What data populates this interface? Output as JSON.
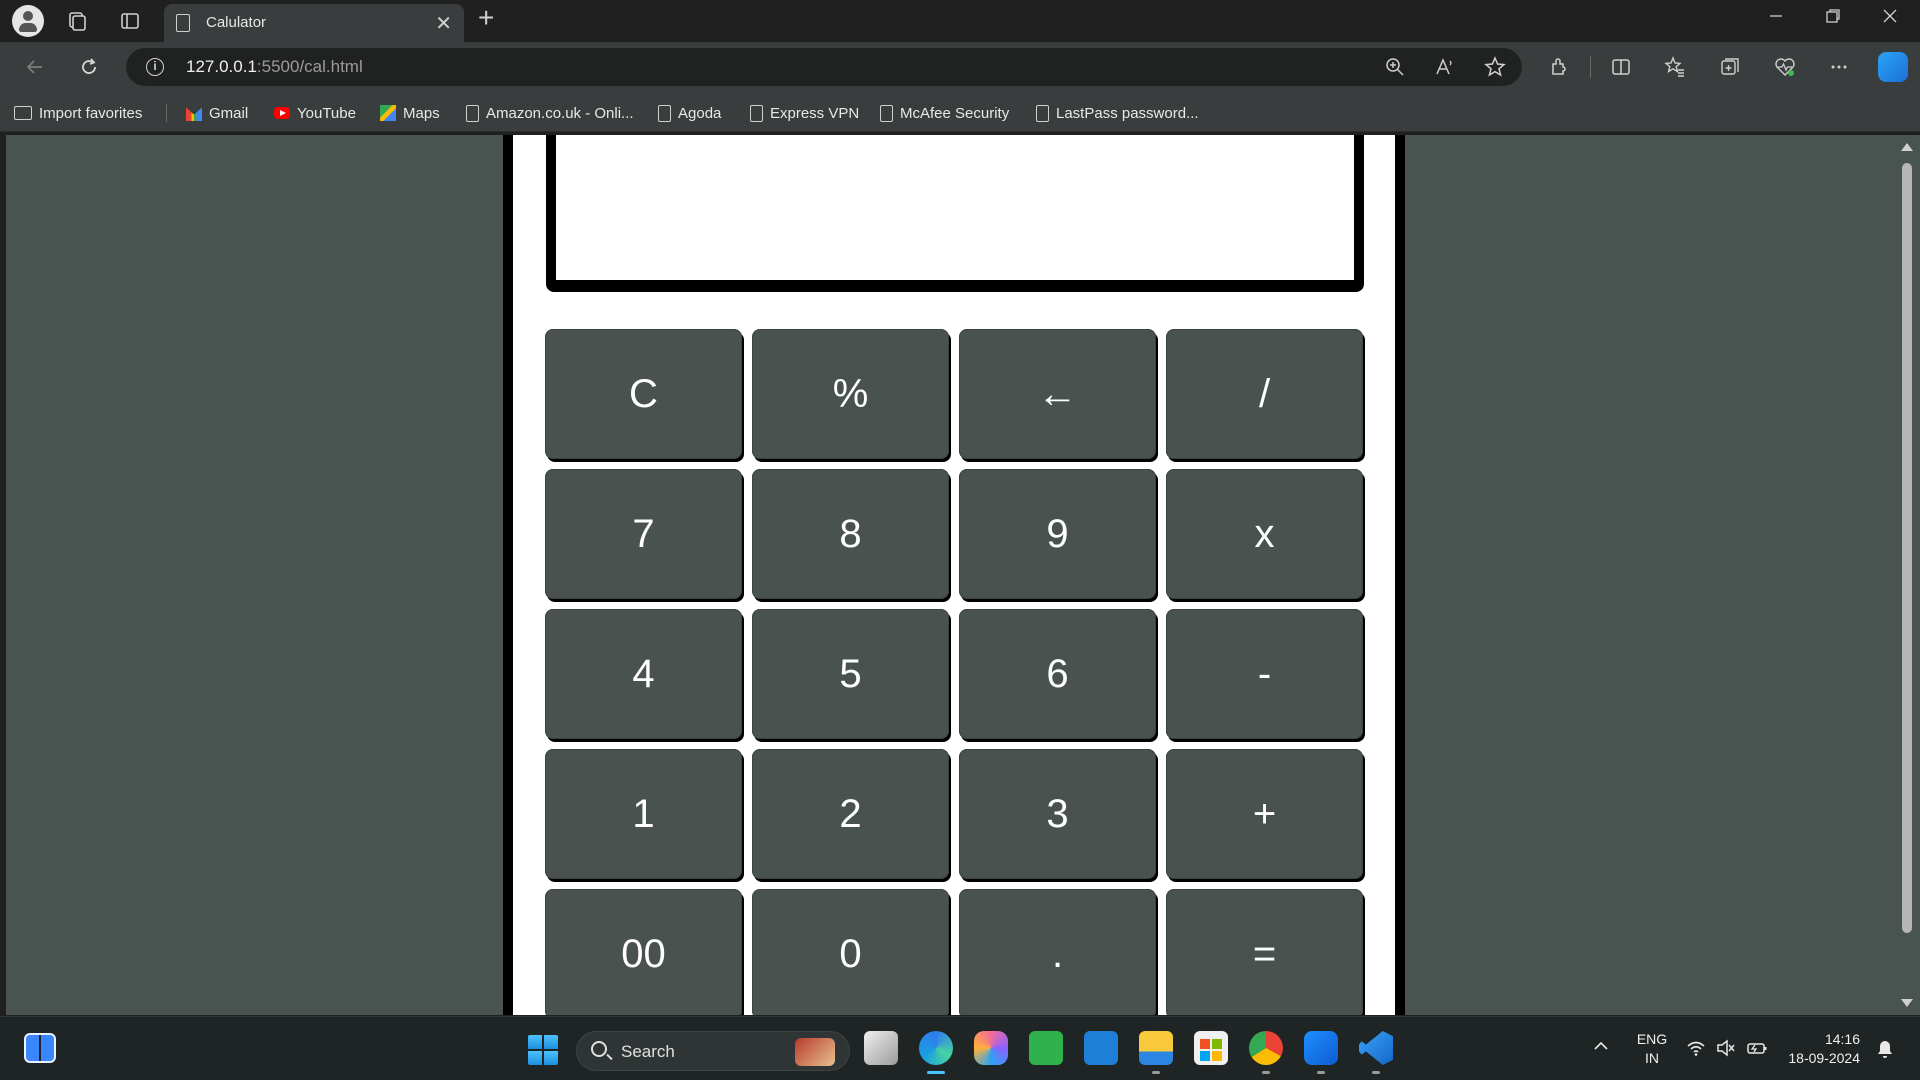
{
  "browser": {
    "tab_title": "Calulator",
    "url_host": "127.0.0.1",
    "url_rest": ":5500/cal.html",
    "new_tab_symbol": "+",
    "tab_close_symbol": "✕"
  },
  "favorites": [
    {
      "label": "Import favorites",
      "icon": "folder-import-icon"
    },
    {
      "label": "Gmail",
      "icon": "gmail-icon"
    },
    {
      "label": "YouTube",
      "icon": "youtube-icon"
    },
    {
      "label": "Maps",
      "icon": "maps-icon"
    },
    {
      "label": "Amazon.co.uk - Onli...",
      "icon": "page-icon"
    },
    {
      "label": "Agoda",
      "icon": "page-icon"
    },
    {
      "label": "Express VPN",
      "icon": "page-icon"
    },
    {
      "label": "McAfee Security",
      "icon": "page-icon"
    },
    {
      "label": "LastPass password...",
      "icon": "page-icon"
    }
  ],
  "calculator": {
    "display_value": "",
    "rows": [
      [
        "C",
        "%",
        "←",
        "/"
      ],
      [
        "7",
        "8",
        "9",
        "x"
      ],
      [
        "4",
        "5",
        "6",
        "-"
      ],
      [
        "1",
        "2",
        "3",
        "+"
      ],
      [
        "00",
        "0",
        ".",
        "="
      ]
    ]
  },
  "taskbar": {
    "search_label": "Search",
    "language_line1": "ENG",
    "language_line2": "IN",
    "time": "14:16",
    "date": "18-09-2024"
  },
  "colors": {
    "page_background": "#495350",
    "key_background": "#4a5250",
    "key_text": "#ffffff",
    "browser_chrome": "#3a3d3d"
  }
}
